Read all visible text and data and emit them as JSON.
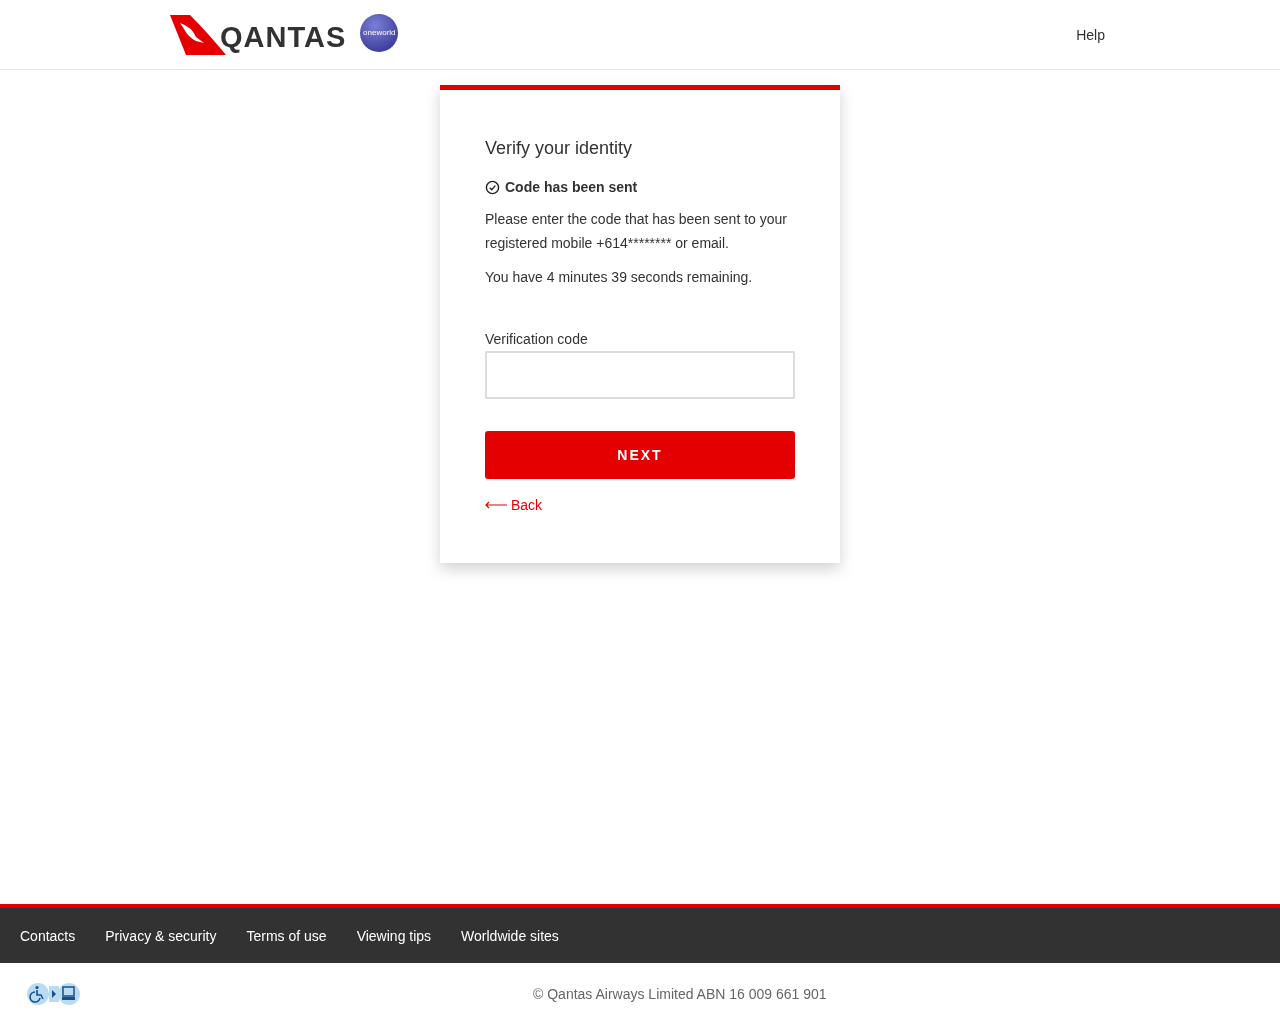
{
  "header": {
    "logo_text": "QANTAS",
    "alliance_badge": "oneworld",
    "help_link": "Help"
  },
  "card": {
    "title": "Verify your identity",
    "status": "Code has been sent",
    "paragraphs": [
      "Please enter the code that has been sent to your registered mobile +614******** or email.",
      "You have 4 minutes 39 seconds remaining."
    ],
    "field": {
      "label": "Verification code"
    },
    "submit": "NEXT",
    "back": "Back"
  },
  "footer": {
    "links": [
      "Contacts",
      "Privacy & security",
      "Terms of use",
      "Viewing tips",
      "Worldwide sites"
    ],
    "copyright": "© Qantas Airways Limited ABN 16 009 661 901"
  }
}
